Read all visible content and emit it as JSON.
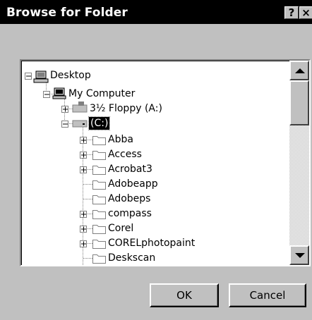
{
  "window": {
    "title": "Browse for Folder",
    "help_label": "?",
    "close_label": "×"
  },
  "tree": {
    "items": [
      {
        "label": "Desktop",
        "icon": "desktop-icon",
        "expander": "-"
      },
      {
        "label": "My Computer",
        "icon": "computer-icon",
        "expander": "-"
      },
      {
        "label": "3½ Floppy (A:)",
        "icon": "floppy-drive-icon",
        "expander": "+"
      },
      {
        "label": "(C:)",
        "icon": "hard-drive-icon",
        "expander": "-",
        "selected": true
      },
      {
        "label": "Abba",
        "icon": "folder-icon",
        "expander": "+"
      },
      {
        "label": "Access",
        "icon": "folder-icon",
        "expander": "+"
      },
      {
        "label": "Acrobat3",
        "icon": "folder-icon",
        "expander": "+"
      },
      {
        "label": "Adobeapp",
        "icon": "folder-icon",
        "expander": ""
      },
      {
        "label": "Adobeps",
        "icon": "folder-icon",
        "expander": ""
      },
      {
        "label": "compass",
        "icon": "folder-icon",
        "expander": "+"
      },
      {
        "label": "Corel",
        "icon": "folder-icon",
        "expander": "+"
      },
      {
        "label": "CORELphotopaint",
        "icon": "folder-icon",
        "expander": "+"
      },
      {
        "label": "Deskscan",
        "icon": "folder-icon",
        "expander": ""
      }
    ]
  },
  "buttons": {
    "ok_label": "OK",
    "cancel_label": "Cancel"
  },
  "colors": {
    "face": "#c0c0c0",
    "titlebar": "#000000",
    "selection": "#000000"
  }
}
